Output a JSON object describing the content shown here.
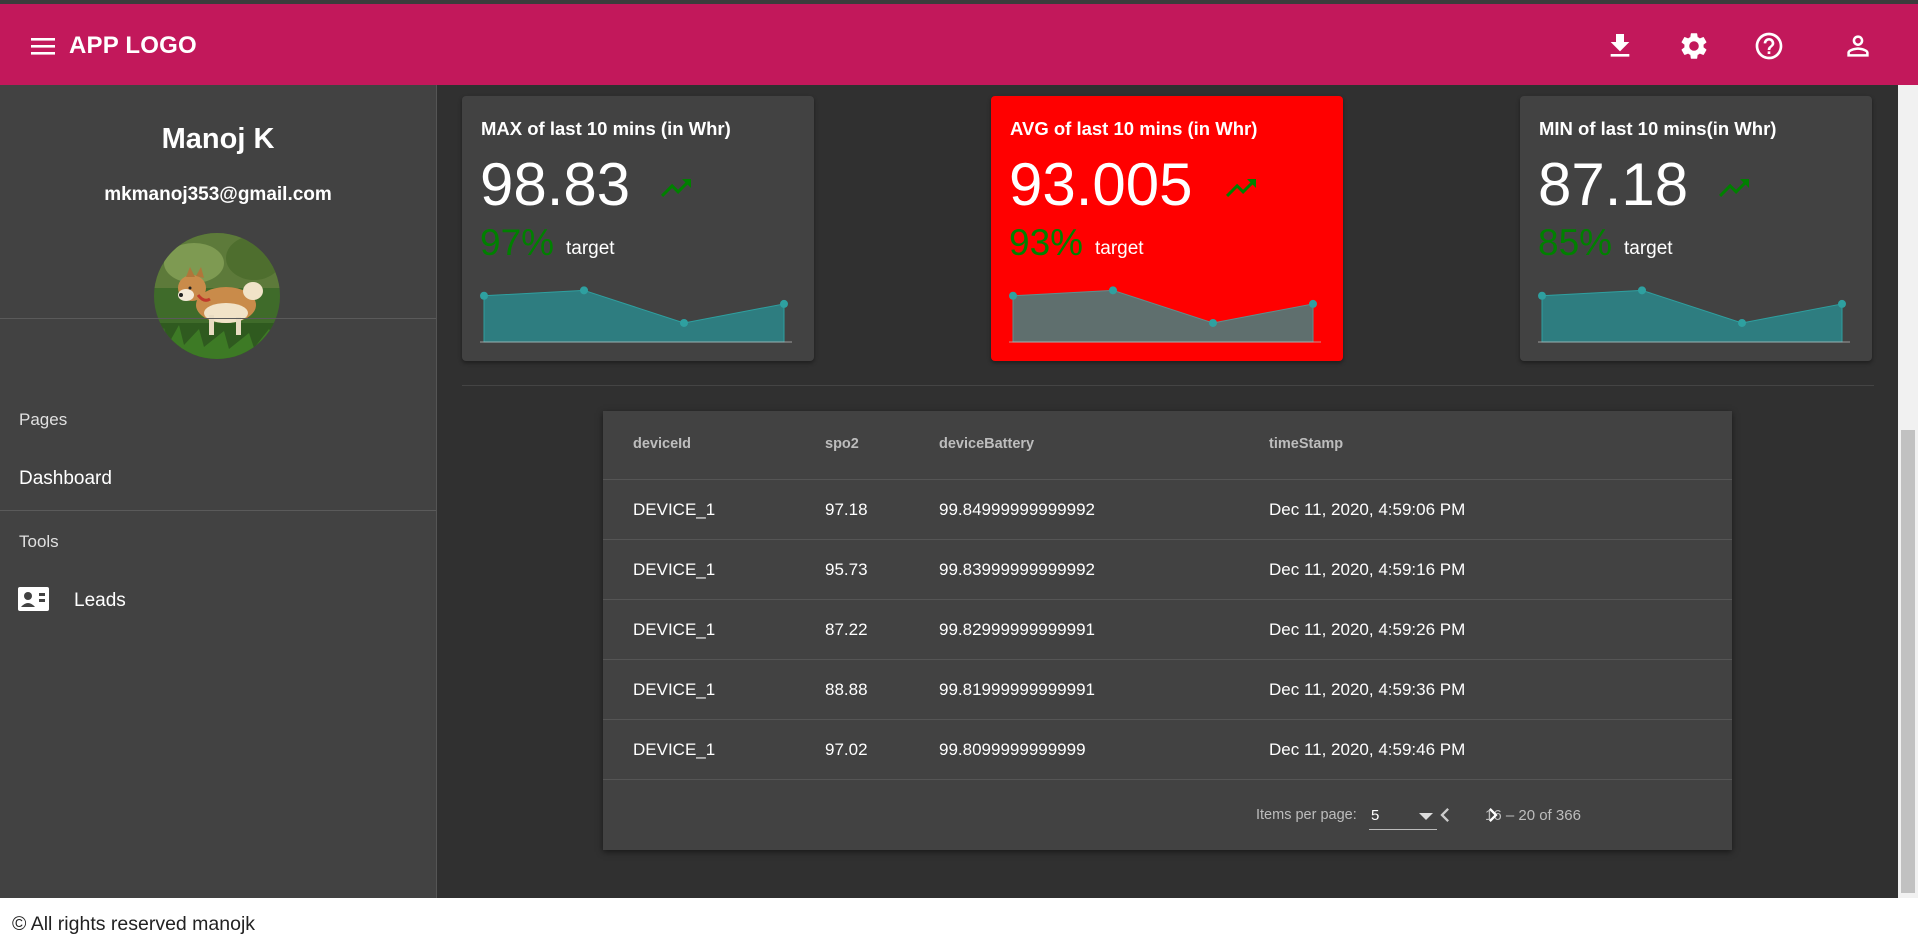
{
  "colors": {
    "toolbar": "#c2185b",
    "sidebar": "#424242",
    "background": "#303030",
    "accent_red": "#ff0000",
    "trend_green": "#008000",
    "spark_fill": "#2e7d80"
  },
  "toolbar": {
    "logo": "APP LOGO",
    "icons": [
      "menu-icon",
      "download-icon",
      "settings-icon",
      "help-icon",
      "account-icon"
    ]
  },
  "sidebar": {
    "name": "Manoj K",
    "email": "mkmanoj353@gmail.com",
    "sections": [
      {
        "title": "Pages",
        "items": [
          {
            "label": "Dashboard"
          }
        ]
      },
      {
        "title": "Tools",
        "items": [
          {
            "label": "Leads",
            "icon": "contact-card-icon"
          }
        ]
      }
    ]
  },
  "cards": [
    {
      "title": "MAX of last 10 mins (in Whr)",
      "value": "98.83",
      "percent": "97%",
      "target_label": "target",
      "trend_icon": "trending-up-icon",
      "highlight": false,
      "sparkline": [
        92,
        94,
        82,
        89
      ]
    },
    {
      "title": "AVG of last 10 mins (in Whr)",
      "value": "93.005",
      "percent": "93%",
      "target_label": "target",
      "trend_icon": "trending-up-icon",
      "highlight": true,
      "sparkline": [
        92,
        94,
        82,
        89
      ]
    },
    {
      "title": "MIN of last 10 mins(in Whr)",
      "value": "87.18",
      "percent": "85%",
      "target_label": "target",
      "trend_icon": "trending-up-icon",
      "highlight": false,
      "sparkline": [
        92,
        94,
        82,
        89
      ]
    }
  ],
  "table": {
    "columns": [
      "deviceId",
      "spo2",
      "deviceBattery",
      "timeStamp"
    ],
    "rows": [
      [
        "DEVICE_1",
        "97.18",
        "99.84999999999992",
        "Dec 11, 2020, 4:59:06 PM"
      ],
      [
        "DEVICE_1",
        "95.73",
        "99.83999999999992",
        "Dec 11, 2020, 4:59:16 PM"
      ],
      [
        "DEVICE_1",
        "87.22",
        "99.82999999999991",
        "Dec 11, 2020, 4:59:26 PM"
      ],
      [
        "DEVICE_1",
        "88.88",
        "99.81999999999991",
        "Dec 11, 2020, 4:59:36 PM"
      ],
      [
        "DEVICE_1",
        "97.02",
        "99.8099999999999",
        "Dec 11, 2020, 4:59:46 PM"
      ]
    ],
    "paginator": {
      "items_per_page_label": "Items per page:",
      "page_size": "5",
      "range_label": "16 – 20 of 366"
    }
  },
  "footer": {
    "text": "© All rights reserved manojk"
  }
}
